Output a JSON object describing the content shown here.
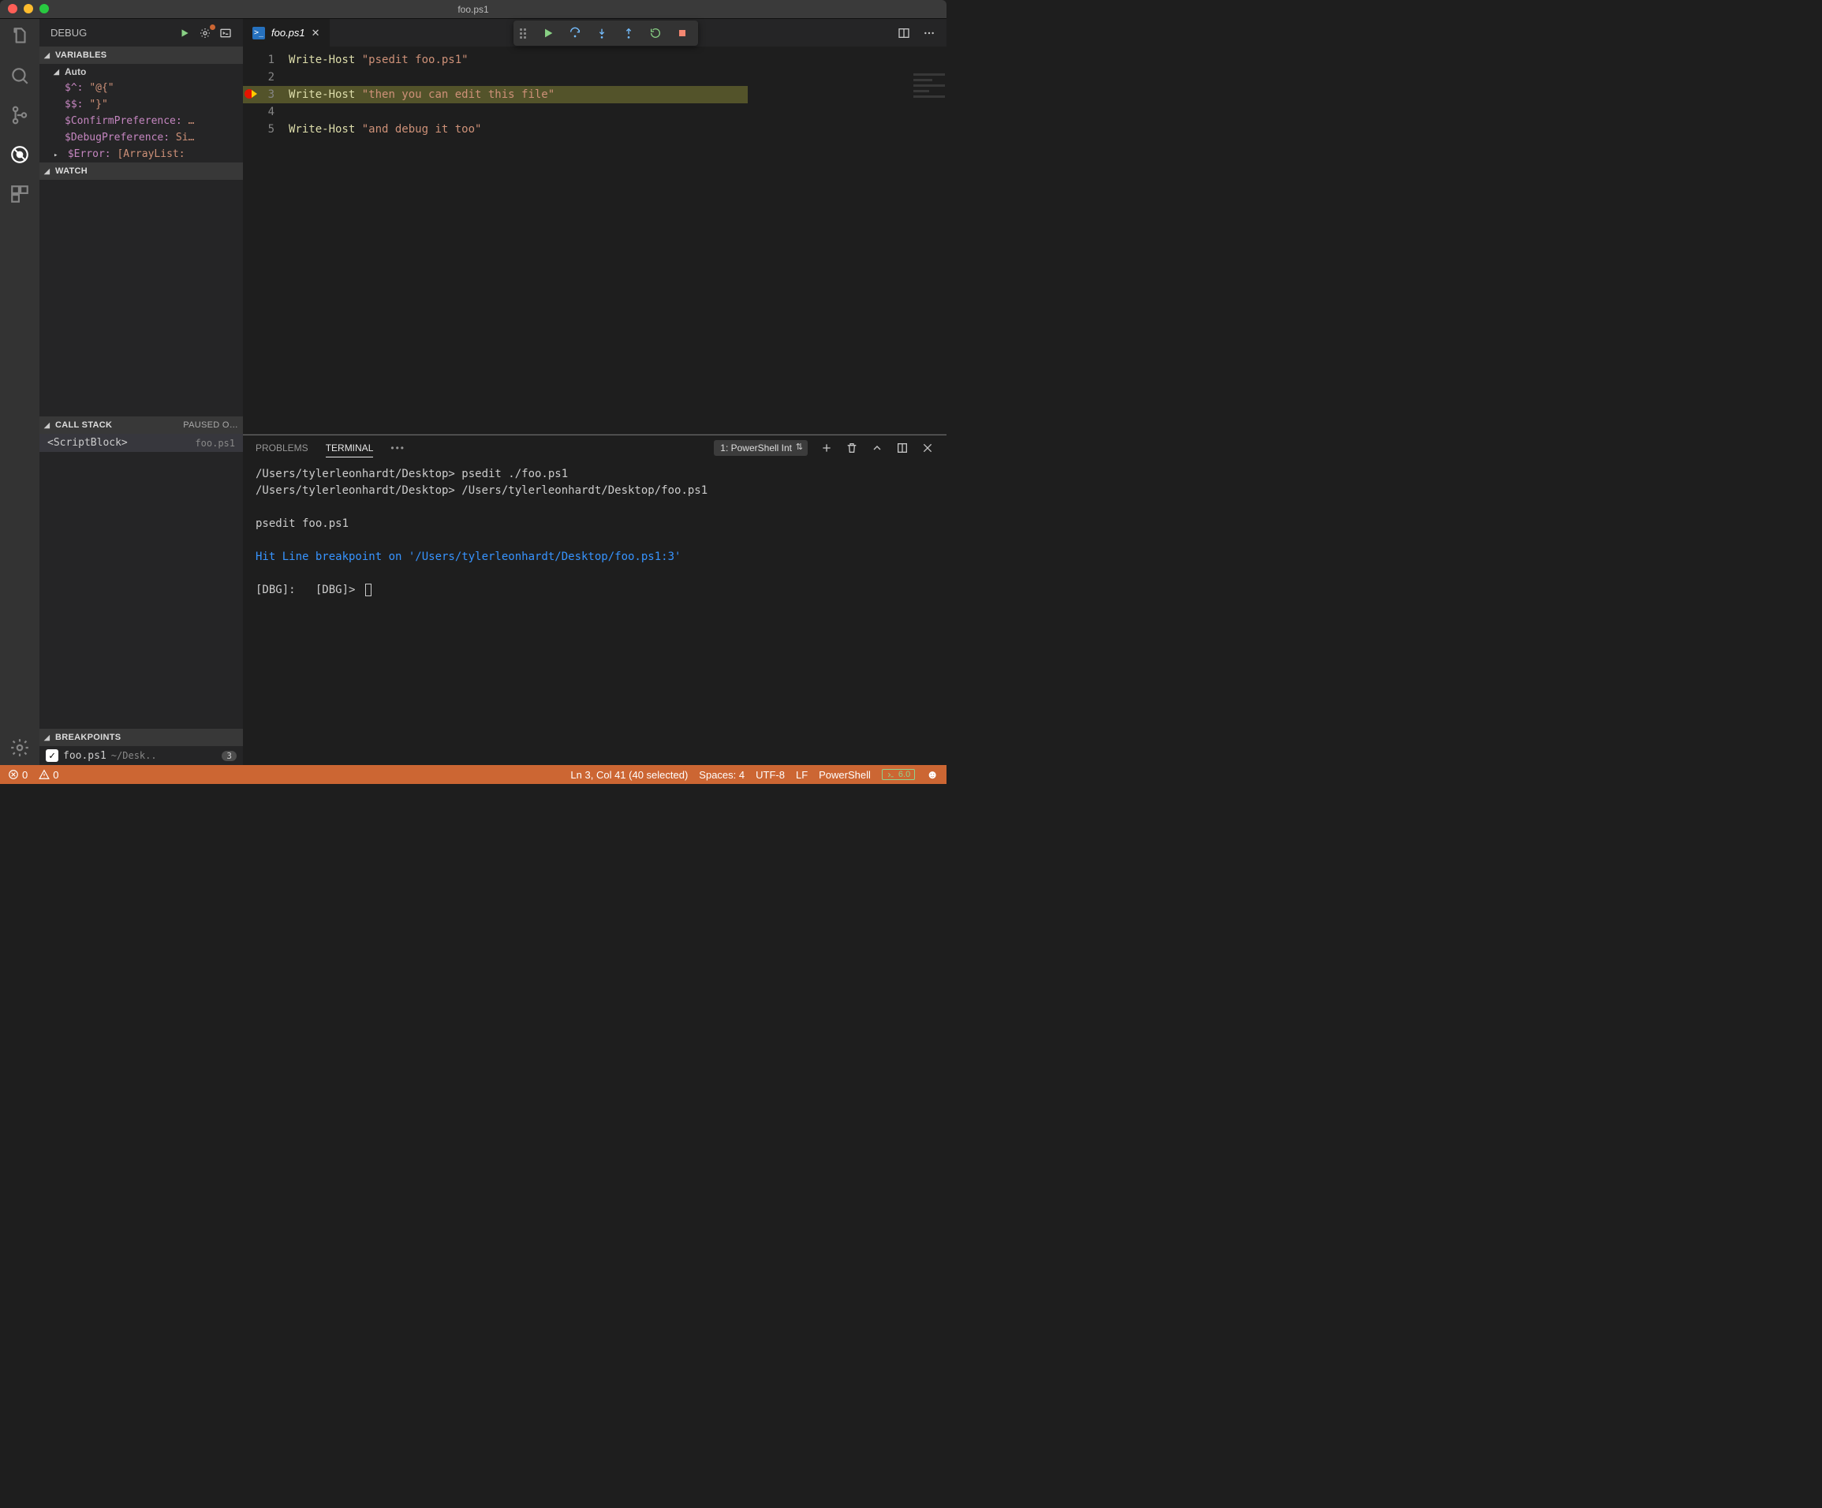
{
  "window": {
    "title": "foo.ps1"
  },
  "activitybar": {
    "items": [
      {
        "name": "files-icon"
      },
      {
        "name": "search-icon"
      },
      {
        "name": "source-control-icon"
      },
      {
        "name": "debug-icon",
        "active": true
      },
      {
        "name": "extensions-icon"
      }
    ],
    "bottom": [
      {
        "name": "settings-gear-icon"
      }
    ]
  },
  "debug": {
    "title": "DEBUG",
    "sections": {
      "variables": {
        "title": "VARIABLES",
        "groups": [
          {
            "name": "Auto",
            "expanded": true,
            "items": [
              {
                "n": "$^:",
                "v": "\"@{\""
              },
              {
                "n": "$$:",
                "v": "\"}\""
              },
              {
                "n": "$ConfirmPreference:",
                "v": "…"
              },
              {
                "n": "$DebugPreference:",
                "v": "Si…"
              },
              {
                "n": "$Error:",
                "v": "[ArrayList:"
              }
            ]
          }
        ]
      },
      "watch": {
        "title": "WATCH"
      },
      "callstack": {
        "title": "CALL STACK",
        "status": "PAUSED O…",
        "frames": [
          {
            "name": "<ScriptBlock>",
            "loc": "foo.ps1"
          }
        ]
      },
      "breakpoints": {
        "title": "BREAKPOINTS",
        "items": [
          {
            "checked": true,
            "file": "foo.ps1",
            "path": "~/Desk..",
            "line": "3"
          }
        ]
      }
    }
  },
  "editor": {
    "tab": {
      "name": "foo.ps1"
    },
    "lines": [
      {
        "num": "1",
        "cmd": "Write-Host",
        "str": " \"psedit foo.ps1\""
      },
      {
        "num": "2",
        "cmd": "",
        "str": ""
      },
      {
        "num": "3",
        "cmd": "Write-Host",
        "str": " \"then you can edit this file\"",
        "bp": true
      },
      {
        "num": "4",
        "cmd": "",
        "str": ""
      },
      {
        "num": "5",
        "cmd": "Write-Host",
        "str": " \"and debug it too\""
      }
    ]
  },
  "debug_toolbar": {
    "buttons": [
      "continue",
      "step-over",
      "step-into",
      "step-out",
      "restart",
      "stop"
    ]
  },
  "panel": {
    "tabs": {
      "problems": "PROBLEMS",
      "terminal": "TERMINAL"
    },
    "terminal_select": "1: PowerShell Int",
    "terminal": {
      "l1": "/Users/tylerleonhardt/Desktop> psedit ./foo.ps1",
      "l2": "/Users/tylerleonhardt/Desktop> /Users/tylerleonhardt/Desktop/foo.ps1",
      "l3": "",
      "l4": "psedit foo.ps1",
      "l5": "",
      "hit": "Hit Line breakpoint on '/Users/tylerleonhardt/Desktop/foo.ps1:3'",
      "prompt": "[DBG]:   [DBG]> "
    }
  },
  "status": {
    "errors": "0",
    "warnings": "0",
    "pos": "Ln 3, Col 41 (40 selected)",
    "spaces": "Spaces: 4",
    "encoding": "UTF-8",
    "eol": "LF",
    "lang": "PowerShell",
    "ps_version": "6.0"
  }
}
